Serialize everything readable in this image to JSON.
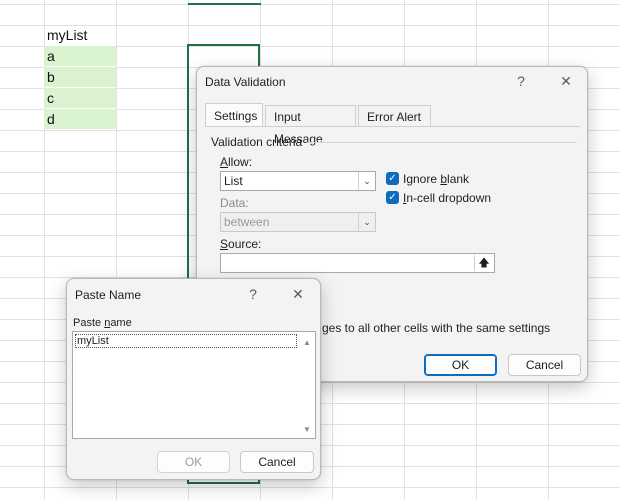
{
  "sheet": {
    "header_cell": "myList",
    "items": [
      "a",
      "b",
      "c",
      "d"
    ]
  },
  "data_validation": {
    "title": "Data Validation",
    "help_glyph": "?",
    "close_glyph": "✕",
    "tabs": [
      "Settings",
      "Input Message",
      "Error Alert"
    ],
    "active_tab": "Settings",
    "section_label": "Validation criteria",
    "allow_label": "Allow:",
    "allow_value": "List",
    "data_label": "Data:",
    "data_value": "between",
    "ignore_blank_label": "Ignore blank",
    "ignore_blank_checked": true,
    "incell_dropdown_label": "In-cell dropdown",
    "incell_dropdown_checked": true,
    "source_label": "Source:",
    "source_value": "",
    "apply_text": "ges to all other cells with the same settings",
    "ok_label": "OK",
    "cancel_label": "Cancel"
  },
  "paste_name": {
    "title": "Paste Name",
    "help_glyph": "?",
    "close_glyph": "✕",
    "list_label": "Paste name",
    "names": [
      "myList"
    ],
    "ok_label": "OK",
    "cancel_label": "Cancel"
  },
  "colors": {
    "accent": "#0f6cbd",
    "selection_border": "#1e7145",
    "list_fill": "#d9f2d0"
  }
}
